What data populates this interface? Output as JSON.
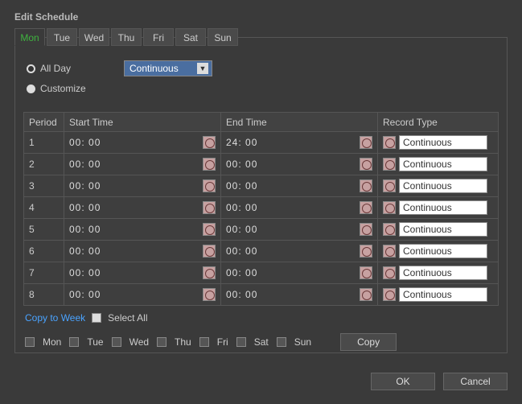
{
  "title": "Edit Schedule",
  "tabs": [
    "Mon",
    "Tue",
    "Wed",
    "Thu",
    "Fri",
    "Sat",
    "Sun"
  ],
  "active_tab_index": 0,
  "mode": {
    "all_day_label": "All Day",
    "customize_label": "Customize",
    "selected": "all_day",
    "type_select": {
      "value": "Continuous"
    }
  },
  "table": {
    "headers": {
      "period": "Period",
      "start": "Start Time",
      "end": "End Time",
      "type": "Record Type"
    },
    "rows": [
      {
        "period": "1",
        "start": "00: 00",
        "end": "24: 00",
        "type": "Continuous"
      },
      {
        "period": "2",
        "start": "00: 00",
        "end": "00: 00",
        "type": "Continuous"
      },
      {
        "period": "3",
        "start": "00: 00",
        "end": "00: 00",
        "type": "Continuous"
      },
      {
        "period": "4",
        "start": "00: 00",
        "end": "00: 00",
        "type": "Continuous"
      },
      {
        "period": "5",
        "start": "00: 00",
        "end": "00: 00",
        "type": "Continuous"
      },
      {
        "period": "6",
        "start": "00: 00",
        "end": "00: 00",
        "type": "Continuous"
      },
      {
        "period": "7",
        "start": "00: 00",
        "end": "00: 00",
        "type": "Continuous"
      },
      {
        "period": "8",
        "start": "00: 00",
        "end": "00: 00",
        "type": "Continuous"
      }
    ]
  },
  "copy": {
    "copy_to_week_label": "Copy to Week",
    "select_all_label": "Select All",
    "days": [
      "Mon",
      "Tue",
      "Wed",
      "Thu",
      "Fri",
      "Sat",
      "Sun"
    ],
    "copy_button": "Copy"
  },
  "footer": {
    "ok": "OK",
    "cancel": "Cancel"
  }
}
